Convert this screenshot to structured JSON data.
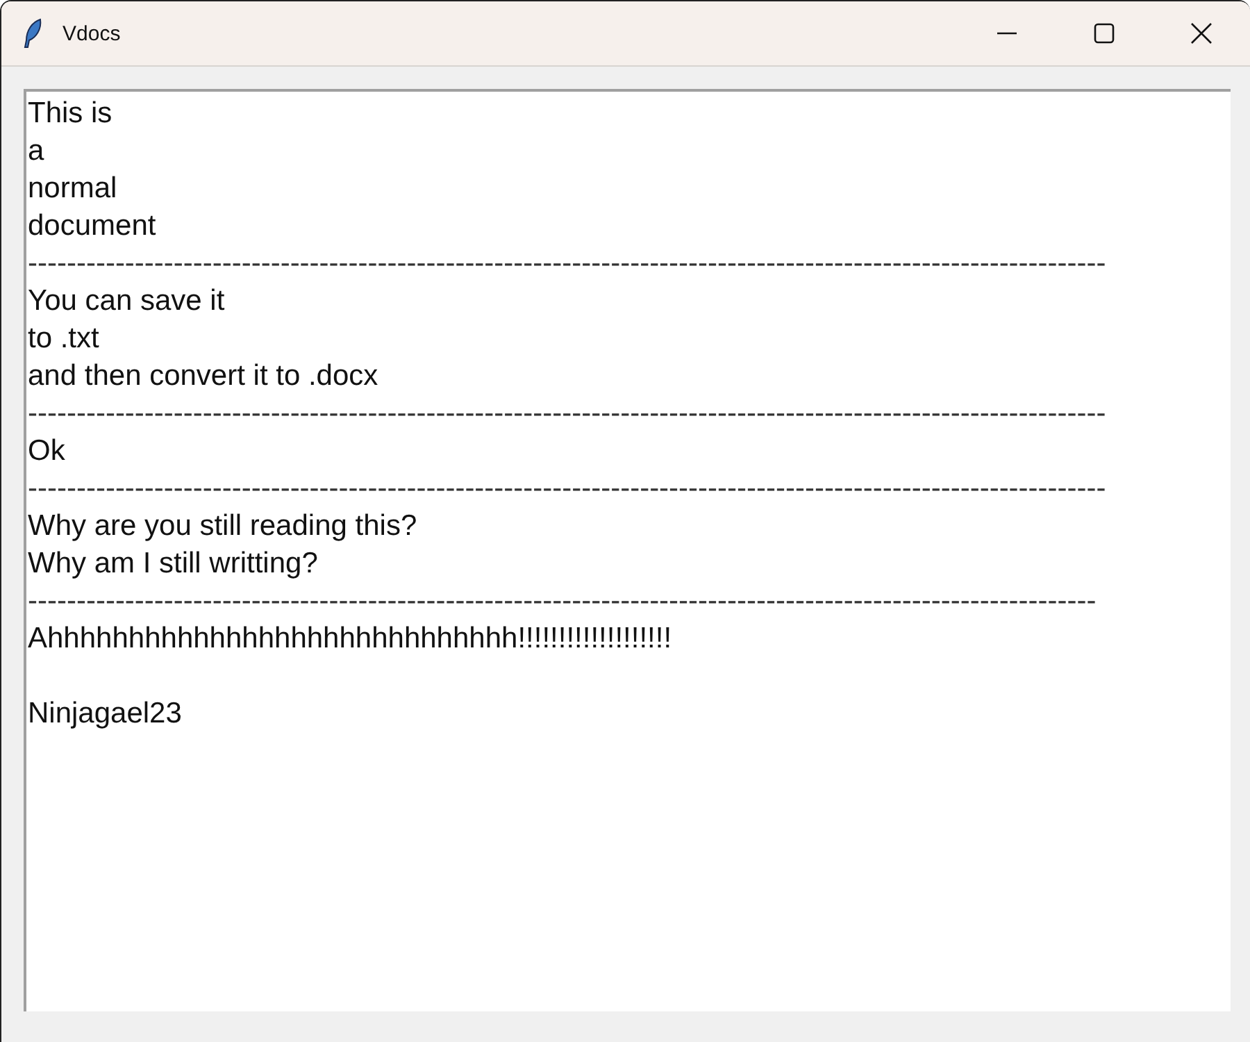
{
  "window": {
    "title": "Vdocs"
  },
  "document": {
    "lines": [
      {
        "kind": "text",
        "text": "This is"
      },
      {
        "kind": "text",
        "text": "a"
      },
      {
        "kind": "text",
        "text": "normal"
      },
      {
        "kind": "text",
        "text": "document"
      },
      {
        "kind": "rule",
        "text": "---------------------------------------------------------------------------------------------------------------"
      },
      {
        "kind": "text",
        "text": "You can save it"
      },
      {
        "kind": "text",
        "text": "to .txt"
      },
      {
        "kind": "text",
        "text": "and then convert it to .docx"
      },
      {
        "kind": "rule",
        "text": "---------------------------------------------------------------------------------------------------------------"
      },
      {
        "kind": "text",
        "text": "Ok"
      },
      {
        "kind": "rule",
        "text": "---------------------------------------------------------------------------------------------------------------"
      },
      {
        "kind": "text",
        "text": "Why are you still reading this?"
      },
      {
        "kind": "text",
        "text": "Why am I still writting?"
      },
      {
        "kind": "rule",
        "text": "--------------------------------------------------------------------------------------------------------------"
      },
      {
        "kind": "text",
        "text": "Ahhhhhhhhhhhhhhhhhhhhhhhhhhhhh!!!!!!!!!!!!!!!!!!!"
      },
      {
        "kind": "blank"
      },
      {
        "kind": "text",
        "text": "Ninjagael23"
      }
    ]
  }
}
